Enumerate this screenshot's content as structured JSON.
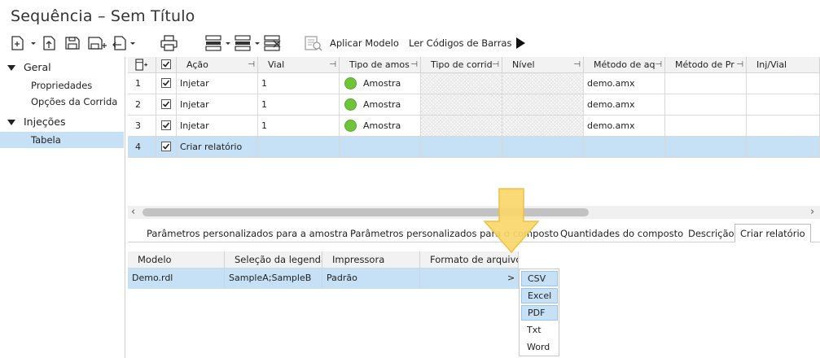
{
  "window": {
    "title": "Sequência – Sem Título"
  },
  "toolbar": {
    "icons": [
      "new-dropdown-icon",
      "open-icon",
      "save-icon",
      "save-as-icon",
      "import-dropdown-icon",
      "print-icon",
      "insert-row-dropdown-icon",
      "insert-row-below-dropdown-icon",
      "delete-rows-icon",
      "apply-template-icon",
      "run-icon"
    ],
    "apply_template": "Aplicar Modelo",
    "read_barcodes": "Ler Códigos de Barras"
  },
  "tree": {
    "items": [
      {
        "label": "Geral",
        "level": 0
      },
      {
        "label": "Propriedades",
        "level": 1
      },
      {
        "label": "Opções da Corrida",
        "level": 1
      },
      {
        "label": "Injeções",
        "level": 0
      },
      {
        "label": "Tabela",
        "level": 1,
        "selected": true
      }
    ]
  },
  "grid": {
    "columns": [
      "Ação",
      "Vial",
      "Tipo de amos",
      "Tipo de corrid",
      "Nível",
      "Método de aq",
      "Método de Pr",
      "Inj/Vial"
    ],
    "rows": [
      {
        "num": "1",
        "checked": true,
        "acao": "Injetar",
        "vial": "1",
        "tipo": "Amostra",
        "metodo": "demo.amx"
      },
      {
        "num": "2",
        "checked": true,
        "acao": "Injetar",
        "vial": "1",
        "tipo": "Amostra",
        "metodo": "demo.amx"
      },
      {
        "num": "3",
        "checked": true,
        "acao": "Injetar",
        "vial": "1",
        "tipo": "Amostra",
        "metodo": "demo.amx"
      },
      {
        "num": "4",
        "checked": true,
        "acao": "Criar relatório",
        "vial": "",
        "tipo": "",
        "metodo": "",
        "selected": true
      }
    ],
    "sample_color": "#6fc43a"
  },
  "tabs": [
    {
      "label": "Parâmetros personalizados para a amostra"
    },
    {
      "label": "Parâmetros personalizados para o composto"
    },
    {
      "label": "Quantidades do composto"
    },
    {
      "label": "Descrição"
    },
    {
      "label": "Criar relatório",
      "active": true
    }
  ],
  "report": {
    "columns": [
      "Modelo",
      "Seleção da legenda",
      "Impressora",
      "Formato de arquivo"
    ],
    "row": {
      "modelo": "Demo.rdl",
      "legenda": "SampleA;SampleB",
      "impressora": "Padrão",
      "formato": "",
      "expander": ">"
    }
  },
  "format_dropdown": {
    "options": [
      "CSV",
      "Excel",
      "PDF",
      "Txt",
      "Word"
    ],
    "highlighted": [
      "CSV",
      "Excel",
      "PDF"
    ]
  },
  "colors": {
    "selection": "#c6e1f5",
    "annotation_arrow": "#f9d76a"
  }
}
